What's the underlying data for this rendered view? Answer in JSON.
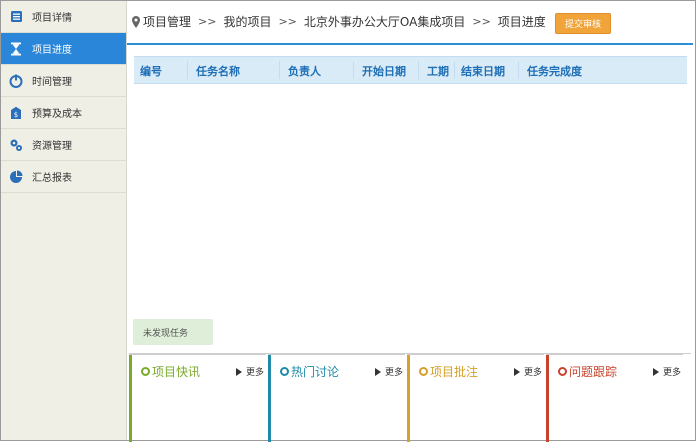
{
  "sidebar": {
    "items": [
      {
        "label": "项目详情",
        "icon": "list-icon",
        "active": false
      },
      {
        "label": "项目进度",
        "icon": "hourglass-icon",
        "active": true
      },
      {
        "label": "时间管理",
        "icon": "power-clock-icon",
        "active": false
      },
      {
        "label": "预算及成本",
        "icon": "money-tag-icon",
        "active": false
      },
      {
        "label": "资源管理",
        "icon": "gears-icon",
        "active": false
      },
      {
        "label": "汇总报表",
        "icon": "pie-chart-icon",
        "active": false
      }
    ]
  },
  "breadcrumb": {
    "items": [
      "项目管理",
      "我的项目",
      "北京外事办公大厅OA集成项目",
      "项目进度"
    ],
    "separator": ">>"
  },
  "submit_button": "提交审核",
  "table": {
    "columns": [
      "编号",
      "任务名称",
      "负责人",
      "开始日期",
      "工期",
      "结束日期",
      "任务完成度"
    ]
  },
  "status_text": "未发现任务",
  "panels": [
    {
      "title": "项目快讯",
      "color": "#7aaa2a",
      "more": "更多"
    },
    {
      "title": "热门讨论",
      "color": "#1f8aa8",
      "more": "更多"
    },
    {
      "title": "项目批注",
      "color": "#d6a02a",
      "more": "更多"
    },
    {
      "title": "问题跟踪",
      "color": "#c8432c",
      "more": "更多"
    }
  ],
  "colors": {
    "accent": "#2a86d8",
    "button": "#f0a43a"
  }
}
